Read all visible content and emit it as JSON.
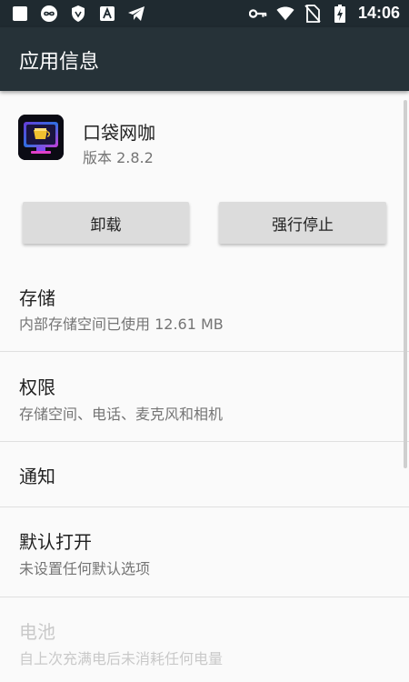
{
  "status_bar": {
    "time": "14:06",
    "left_icons": [
      "square-notification-icon",
      "infinity-app-icon",
      "shield-app-icon",
      "a-app-icon",
      "telegram-icon"
    ],
    "right_icons": [
      "key-icon",
      "wifi-icon",
      "no-sim-icon",
      "battery-charging-icon"
    ]
  },
  "app_bar": {
    "title": "应用信息"
  },
  "app": {
    "name": "口袋网咖",
    "version": "版本 2.8.2",
    "icon": "app-icon-pocket-netcafe"
  },
  "buttons": {
    "uninstall": "卸载",
    "force_stop": "强行停止"
  },
  "settings": [
    {
      "title": "存储",
      "subtitle": "内部存储空间已使用 12.61 MB"
    },
    {
      "title": "权限",
      "subtitle": "存储空间、电话、麦克风和相机"
    },
    {
      "title": "通知"
    },
    {
      "title": "默认打开",
      "subtitle": "未设置任何默认选项"
    },
    {
      "title": "电池",
      "subtitle": "自上次充满电后未消耗任何电量",
      "disabled": true
    }
  ]
}
